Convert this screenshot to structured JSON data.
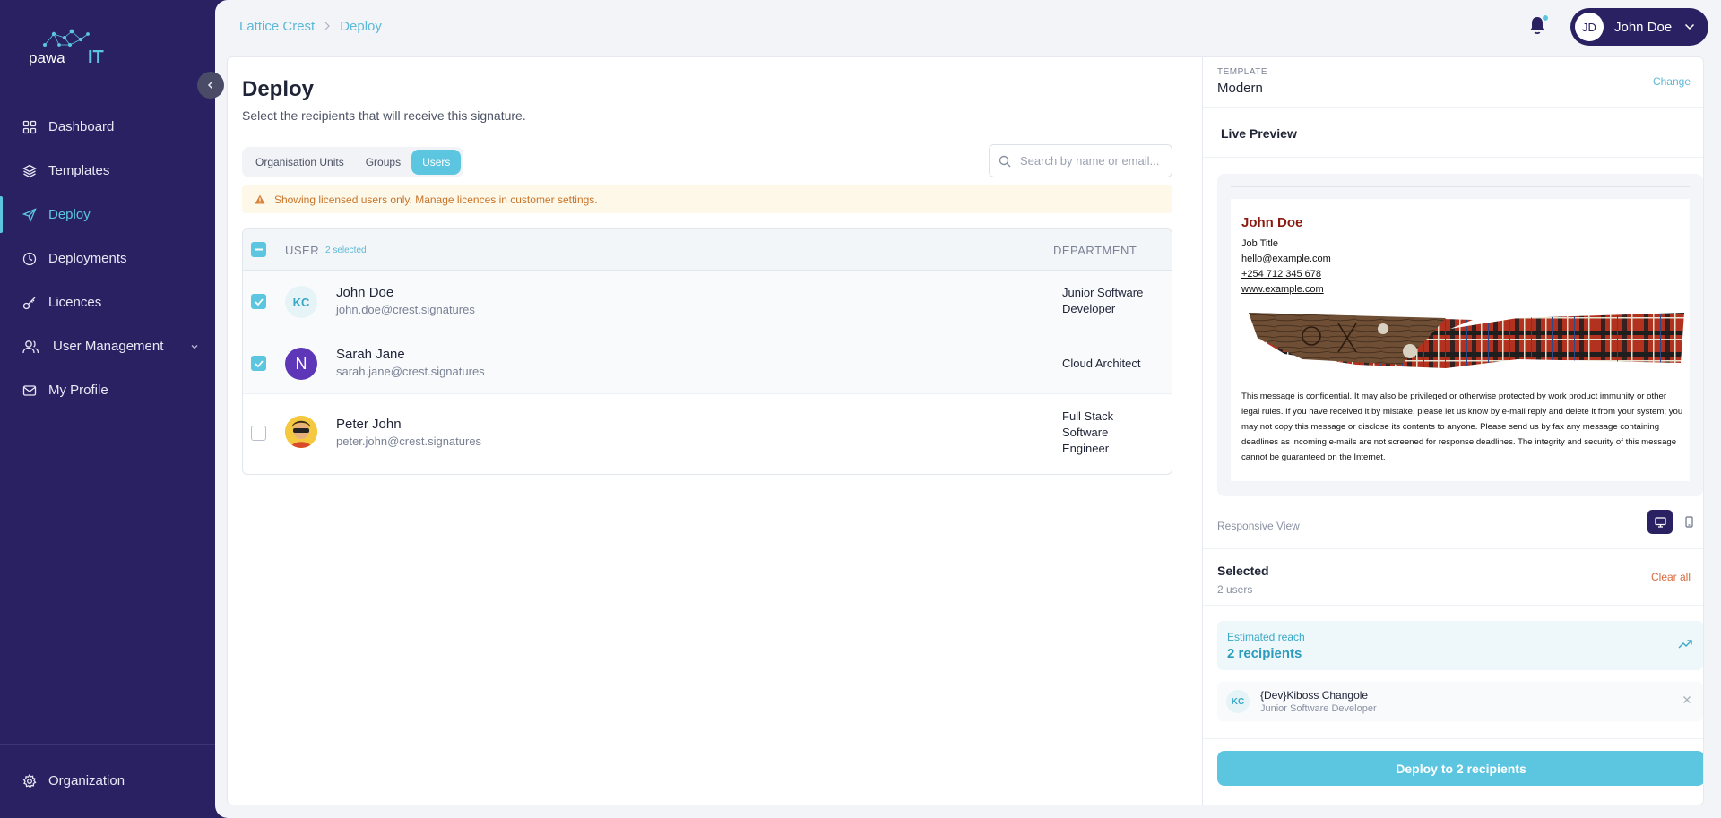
{
  "brand": {
    "logo_text_a": "pawa",
    "logo_text_b": "IT",
    "accent": "#5cc6e0",
    "sidebar_bg": "#2a2163"
  },
  "sidebar": {
    "items": [
      {
        "label": "Dashboard",
        "icon": "grid-icon"
      },
      {
        "label": "Templates",
        "icon": "layers-icon"
      },
      {
        "label": "Deploy",
        "icon": "send-icon",
        "active": true
      },
      {
        "label": "Deployments",
        "icon": "clock-icon"
      },
      {
        "label": "Licences",
        "icon": "key-icon"
      },
      {
        "label": "User Management",
        "icon": "users-icon"
      },
      {
        "label": "My Profile",
        "icon": "mail-icon"
      }
    ],
    "bottom": {
      "label": "Organization",
      "icon": "gear-icon"
    }
  },
  "topbar": {
    "breadcrumb": [
      "Lattice Crest",
      "Deploy"
    ],
    "user": {
      "initials": "JD",
      "name": "John Doe"
    }
  },
  "main": {
    "title": "Deploy",
    "subtitle": "Select the recipients that will receive this signature.",
    "tabs": [
      "Organisation Units",
      "Groups",
      "Users"
    ],
    "active_tab": "Users",
    "search": {
      "placeholder": "Search by name or email..."
    },
    "alert": "Showing licensed users only. Manage licences in customer settings.",
    "table": {
      "col_user": "USER",
      "selected_count": "2 selected",
      "col_department": "DEPARTMENT",
      "rows": [
        {
          "initials": "KC",
          "name": "John Doe",
          "email": "john.doe@crest.signatures",
          "department": "Junior Software Developer",
          "checked": true
        },
        {
          "initials": "N",
          "name": "Sarah Jane",
          "email": "sarah.jane@crest.signatures",
          "department": "Cloud Architect",
          "checked": true
        },
        {
          "initials": "",
          "name": "Peter John",
          "email": "peter.john@crest.signatures",
          "department": "Full Stack Software Engineer",
          "checked": false
        }
      ]
    }
  },
  "panel": {
    "template_label": "TEMPLATE",
    "template_name": "Modern",
    "change": "Change",
    "live_preview": "Live Preview",
    "signature": {
      "name": "John Doe",
      "job_title": "Job Title",
      "email": "hello@example.com",
      "phone": "+254 712 345 678",
      "website": "www.example.com",
      "disclaimer": "This message is confidential. It may also be privileged or otherwise protected by work product immunity or other legal rules. If you have received it by mistake, please let us know by e-mail reply and delete it from your system; you may not copy this message or disclose its contents to anyone. Please send us by fax any message containing deadlines as incoming e-mails are not screened for response deadlines. The integrity and security of this message cannot be guaranteed on the Internet."
    },
    "responsive_view": "Responsive View",
    "selected_title": "Selected",
    "selected_count": "2 users",
    "clear_all": "Clear all",
    "reach_label": "Estimated reach",
    "reach_value": "2 recipients",
    "selected_items": [
      {
        "initials": "KC",
        "name": "{Dev}Kiboss Changole",
        "role": "Junior Software Developer"
      }
    ],
    "deploy_button": "Deploy to 2 recipients"
  }
}
